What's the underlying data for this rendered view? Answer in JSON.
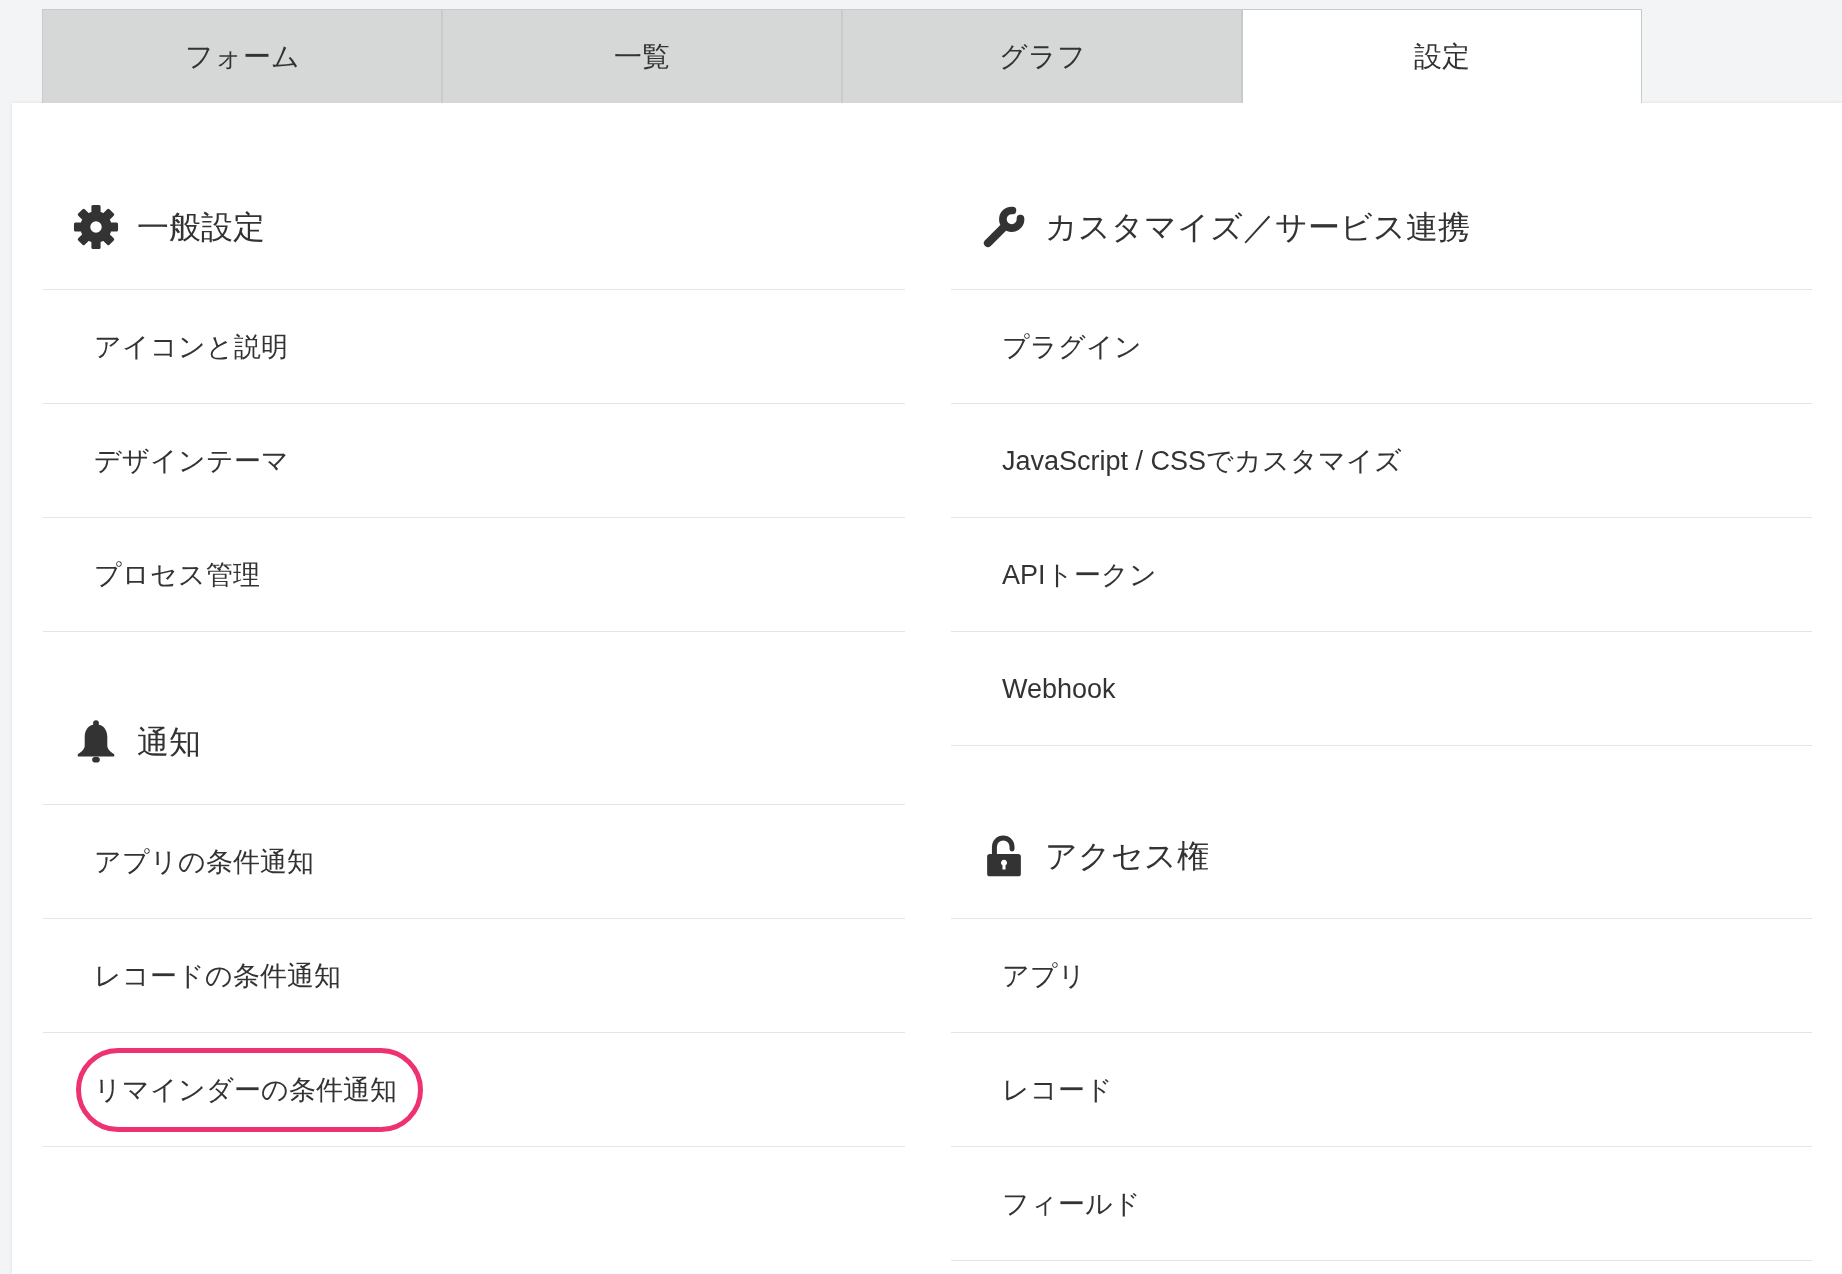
{
  "tabs": [
    {
      "label": "フォーム",
      "selected": false
    },
    {
      "label": "一覧",
      "selected": false
    },
    {
      "label": "グラフ",
      "selected": false
    },
    {
      "label": "設定",
      "selected": true
    }
  ],
  "columns": [
    {
      "sections": [
        {
          "title": "一般設定",
          "items": [
            {
              "label": "アイコンと説明",
              "highlighted": false
            },
            {
              "label": "デザインテーマ",
              "highlighted": false
            },
            {
              "label": "プロセス管理",
              "highlighted": false
            }
          ]
        },
        {
          "title": "通知",
          "items": [
            {
              "label": "アプリの条件通知",
              "highlighted": false
            },
            {
              "label": "レコードの条件通知",
              "highlighted": false
            },
            {
              "label": "リマインダーの条件通知",
              "highlighted": true
            }
          ]
        }
      ]
    },
    {
      "sections": [
        {
          "title": "カスタマイズ／サービス連携",
          "items": [
            {
              "label": "プラグイン",
              "highlighted": false
            },
            {
              "label": "JavaScript / CSSでカスタマイズ",
              "highlighted": false
            },
            {
              "label": "APIトークン",
              "highlighted": false
            },
            {
              "label": "Webhook",
              "highlighted": false
            }
          ]
        },
        {
          "title": "アクセス権",
          "items": [
            {
              "label": "アプリ",
              "highlighted": false
            },
            {
              "label": "レコード",
              "highlighted": false
            },
            {
              "label": "フィールド",
              "highlighted": false
            }
          ]
        }
      ]
    }
  ]
}
